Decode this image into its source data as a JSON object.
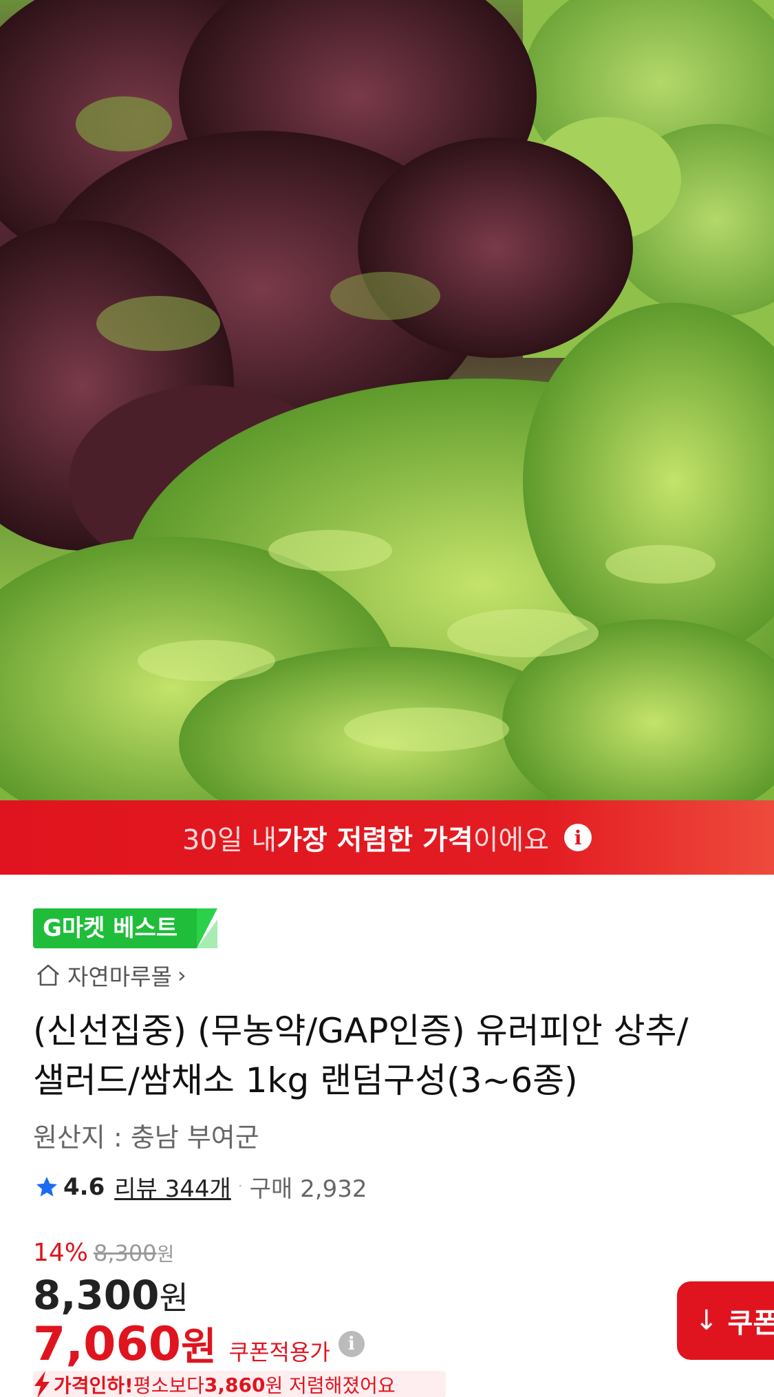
{
  "banner": {
    "prefix": "30일 내 ",
    "highlight": "가장 저렴한 가격",
    "suffix": "이에요",
    "info_glyph": "i"
  },
  "badge": {
    "label": "G마켓 베스트"
  },
  "seller": {
    "name": "자연마루몰",
    "chevron": "›",
    "icon": "home-icon"
  },
  "product": {
    "title_line1": "(신선집중) (무농약/GAP인증) 유러피안 상추/",
    "title_line2": "샐러드/쌈채소 1kg 랜덤구성(3~6종)",
    "origin": "원산지 : 충남 부여군"
  },
  "rating": {
    "score": "4.6",
    "reviews": "리뷰 344개",
    "separator": "·",
    "purchases": "구매 2,932"
  },
  "pricing": {
    "discount_pct": "14%",
    "original_price": "8,300",
    "original_unit": "원",
    "sale_price": "8,300",
    "sale_unit": "원",
    "coupon_price": "7,060",
    "coupon_unit": "원",
    "coupon_label": "쿠폰적용가",
    "info_glyph": "i"
  },
  "coupon_button": {
    "arrow": "↓",
    "label": "쿠폰"
  },
  "price_drop": {
    "lead": "가격인하!",
    "middle": " 평소보다 ",
    "amount": "3,860",
    "tail": "원 저렴해졌어요"
  },
  "colors": {
    "brand_red": "#e0141e",
    "badge_green": "#1fbd3a",
    "star_blue": "#1a6cf0"
  }
}
